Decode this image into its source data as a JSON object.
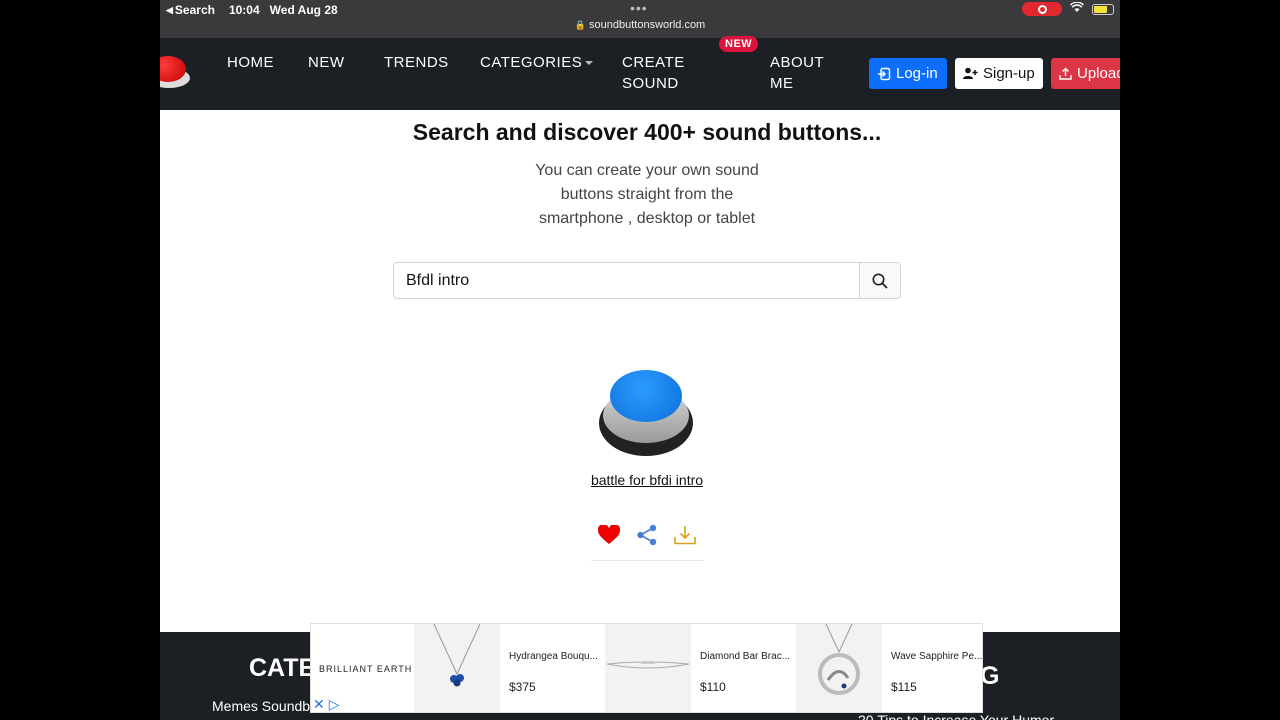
{
  "status_bar": {
    "back_label": "Search",
    "time": "10:04",
    "date": "Wed Aug 28",
    "url": "soundbuttonsworld.com",
    "url_icon": "lock-icon"
  },
  "nav": {
    "items": [
      "HOME",
      "NEW",
      "TRENDS",
      "CATEGORIES",
      "CREATE",
      "SOUND",
      "ABOUT",
      "ME"
    ],
    "new_badge": "NEW",
    "login": "Log-in",
    "signup": "Sign-up",
    "upload": "Upload"
  },
  "hero": {
    "headline": "Search and discover 400+ sound buttons...",
    "subtitle": "You can create your own sound buttons straight from the smartphone , desktop or tablet"
  },
  "search": {
    "value": "Bfdl intro",
    "icon": "search-icon"
  },
  "result": {
    "title": "battle for bfdi intro",
    "button_color": "#1a85f0",
    "actions": [
      "heart-icon",
      "share-icon",
      "download-icon"
    ]
  },
  "footer": {
    "categories_heading": "CATE",
    "right_heading_fragment": "G",
    "memes_link": "Memes Soundb",
    "tips_link": "20 Tips to Increase Your Humor"
  },
  "ad": {
    "brand": "BRILLIANT EARTH",
    "products": [
      {
        "name": "Hydrangea Bouqu...",
        "price": "$375"
      },
      {
        "name": "Diamond Bar Brac...",
        "price": "$110"
      },
      {
        "name": "Wave Sapphire Pe...",
        "price": "$115"
      }
    ]
  },
  "colors": {
    "navbar": "#1c1f23",
    "login": "#0d6efd",
    "upload": "#dc3545",
    "badge": "#dc143c"
  }
}
